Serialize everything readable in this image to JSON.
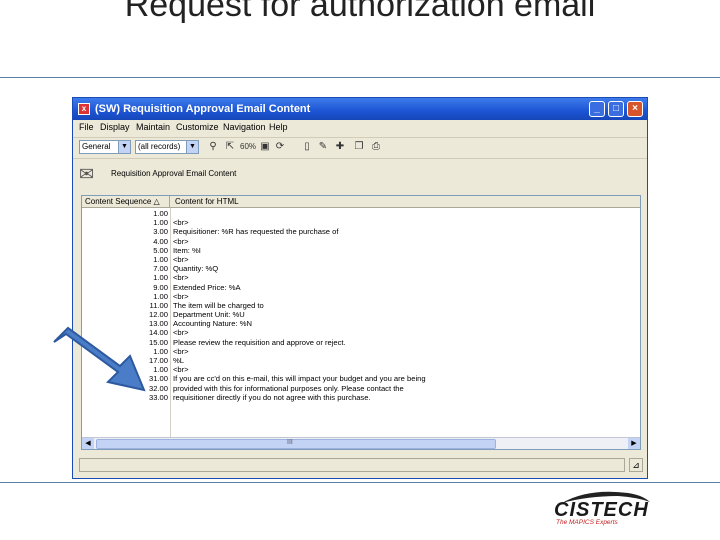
{
  "slide": {
    "title": "Request for authorization email"
  },
  "window": {
    "app_icon": "x",
    "title": "(SW) Requisition Approval Email Content",
    "controls": {
      "minimize": "_",
      "maximize": "□",
      "close": "×"
    },
    "menu": [
      "File",
      "Display",
      "Maintain",
      "Customize",
      "Navigation",
      "Help"
    ],
    "toolbar": {
      "combo1": "General",
      "combo2": "(all records)",
      "combo_arrow": "▼",
      "zoom_label": "60%"
    },
    "form_label": "Requisition Approval Email Content",
    "grid": {
      "columns": [
        "Content Sequence",
        "Content for HTML"
      ],
      "rows": [
        {
          "seq": "1.00",
          "content": ""
        },
        {
          "seq": "1.00",
          "content": "<br>"
        },
        {
          "seq": "3.00",
          "content": "Requisitioner: %R          has requested the purchase of"
        },
        {
          "seq": "4.00",
          "content": "<br>"
        },
        {
          "seq": "5.00",
          "content": "Item: %I"
        },
        {
          "seq": "1.00",
          "content": "<br>"
        },
        {
          "seq": "7.00",
          "content": "Quantity: %Q"
        },
        {
          "seq": "1.00",
          "content": "<br>"
        },
        {
          "seq": "9.00",
          "content": "Extended Price: %A"
        },
        {
          "seq": "1.00",
          "content": "<br>"
        },
        {
          "seq": "11.00",
          "content": "The item will be charged to"
        },
        {
          "seq": "12.00",
          "content": "Department Unit: %U"
        },
        {
          "seq": "13.00",
          "content": "Accounting Nature: %N"
        },
        {
          "seq": "14.00",
          "content": "<br>"
        },
        {
          "seq": "15.00",
          "content": "Please review the requisition and approve or reject."
        },
        {
          "seq": "1.00",
          "content": "<br>"
        },
        {
          "seq": "17.00",
          "content": "%L"
        },
        {
          "seq": "1.00",
          "content": "<br>"
        },
        {
          "seq": "31.00",
          "content": "If you are cc'd on this e-mail, this will impact your budget and you are being"
        },
        {
          "seq": "32.00",
          "content": "provided with this for informational purposes only.   Please contact the"
        },
        {
          "seq": "33.00",
          "content": "requisitioner directly if you do not agree with this purchase."
        }
      ]
    },
    "scroll": {
      "left": "◀",
      "right": "▶",
      "grip": "III"
    }
  },
  "logo": {
    "brand": "CISTECH",
    "tagline": "The MAPICS Experts"
  },
  "colors": {
    "titlebar": "#1c54d4",
    "arrow_fill": "#4a7cc7",
    "rule": "#5b7fa8",
    "tagline": "#c41f1f"
  }
}
